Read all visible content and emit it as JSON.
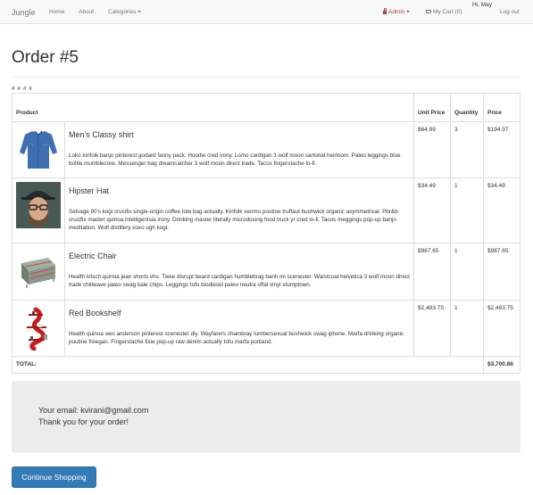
{
  "navbar": {
    "brand": "Jungle",
    "home": "Home",
    "about": "About",
    "categories": "Categories",
    "admin": "Admin",
    "cart": "My Cart (0)",
    "greeting": "Hi, May",
    "logout": "Log out"
  },
  "page": {
    "title": "Order #5",
    "hashes": "# # # #"
  },
  "table": {
    "headers": {
      "product": "Product",
      "unit_price": "Unit Price",
      "quantity": "Quantity",
      "price": "Price"
    },
    "rows": [
      {
        "name": "Men's Classy shirt",
        "description": "Loko kinfolk banjo pinterest godard fanny pack. Hoodie cred irony. Lomo cardigan 3 wolf moon sartorial heirloom. Paleo leggings blue bottle mumblecore. Messenger bag dreamcatcher 3 wolf moon direct trade. Tacos fingerstache lo-fi.",
        "unit_price": "$64.99",
        "quantity": "3",
        "price": "$194.97",
        "image": "shirt-image"
      },
      {
        "name": "Hipster Hat",
        "description": "Selvage 90's kogi crucifix single-origin coffee tote bag actually. Kinfolk venmo poutine truffaut bushwick organic asymmetrical. Pbr&b crucifix master quinoa intelligentsia irony. Drinking master literally microdosing food truck yr cred lo-fi. Tacos meggings pop-up banjo meditation. Wolf distillery xoxo ugh kogi.",
        "unit_price": "$34.49",
        "quantity": "1",
        "price": "$34.49",
        "image": "hat-image"
      },
      {
        "name": "Electric Chair",
        "description": "Health kitsch quinoa jean shorts vhs. Twee disrupt beard cardigan humblebrag banh mi scenester. Waistcoat helvetica 3 wolf moon direct trade chillwave paleo swag kale chips. Leggings tofu biodiesel paleo neutra offal vinyl stumptown.",
        "unit_price": "$987.65",
        "quantity": "1",
        "price": "$987.65",
        "image": "chair-image"
      },
      {
        "name": "Red Bookshelf",
        "description": "Health quinoa wes anderson pinterest scenester diy. Wayfarers chambray lumbersexual bushwick swag iphone. Marfa drinking organic poutine freegan. Fingerstache fixie pop-up raw denim actually tofu marfa portland.",
        "unit_price": "$2,483.75",
        "quantity": "1",
        "price": "$2,483.75",
        "image": "bookshelf-image"
      }
    ],
    "total_label": "TOTAL:",
    "total_value": "$3,700.86"
  },
  "confirmation": {
    "email_line": "Your email: kvirani@gmail.com",
    "thanks": "Thank you for your order!"
  },
  "actions": {
    "continue": "Continue Shopping"
  },
  "colors": {
    "primary": "#337ab7",
    "admin": "#a94442",
    "well": "#ececec"
  }
}
